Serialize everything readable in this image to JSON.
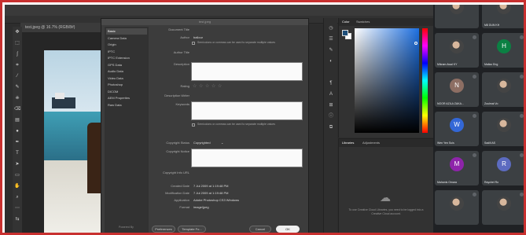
{
  "photoshop": {
    "document_tab": "test.jpeg @ 16.7% (RGB/8#)",
    "tools": [
      "move-icon",
      "marquee-icon",
      "lasso-icon",
      "crop-icon",
      "eyedropper-icon",
      "brush-icon",
      "stamp-icon",
      "eraser-icon",
      "gradient-icon",
      "dodge-icon",
      "pen-icon",
      "type-icon",
      "path-select-icon",
      "shape-icon",
      "hand-icon",
      "zoom-icon",
      "more-icon",
      "swap-colors-icon"
    ],
    "dialog": {
      "title": "test.jpeg",
      "sidebar": [
        "Basic",
        "Camera Data",
        "Origin",
        "IPTC",
        "IPTC Extension",
        "GPS Data",
        "Audio Data",
        "Video Data",
        "Photoshop",
        "DICOM",
        "AEM Properties",
        "Raw Data"
      ],
      "xmp_powered": "Powered By",
      "xmp_logo": "xmp",
      "fields": {
        "document_title_label": "Document Title",
        "author_label": "Author",
        "author_value": "ballour",
        "semicolon_note": "Semicolons or commas can be used to separate multiple values",
        "author_title_label": "Author Title",
        "description_label": "Description",
        "rating_label": "Rating",
        "description_writer_label": "Description Writer",
        "keywords_label": "Keywords",
        "keywords_note": "Semicolons or commas can be used to separate multiple values",
        "copyright_status_label": "Copyright Status",
        "copyright_status_value": "Copyrighted",
        "copyright_notice_label": "Copyright Notice",
        "copyright_info_label": "Copyright Info URL",
        "created_date_label": "Created Date",
        "created_date_value": "7 Jul 2009 at 1:19:48 PM",
        "modified_date_label": "Modification Date",
        "modified_date_value": "7 Jul 2009 at 1:19:48 PM",
        "application_label": "Application",
        "application_value": "Adobe Photoshop CS3 Windows",
        "format_label": "Format",
        "format_value": "image/jpeg"
      },
      "buttons": {
        "preferences": "Preferences",
        "template": "Template Fo...",
        "cancel": "Cancel",
        "ok": "OK"
      }
    },
    "color_panel": {
      "tabs": [
        "Color",
        "Swatches"
      ],
      "foreground_color": "#1e4f7a"
    },
    "libraries_panel": {
      "tabs": [
        "Libraries",
        "Adjustments"
      ],
      "message": "To use Creative Cloud Libraries, you need to be logged into a Creative Cloud account."
    }
  },
  "meeting": {
    "participants": [
      {
        "name": "",
        "initial": "",
        "color": "#3c4043"
      },
      {
        "name": "M8 DUN KH",
        "initial": "",
        "color": "#3c4043"
      },
      {
        "name": "Mikram Awal KY",
        "initial": "",
        "color": "#3c4043"
      },
      {
        "name": "Mallaz Eng",
        "initial": "H",
        "color": "#0b8043"
      },
      {
        "name": "NOOR AZILA ZAKA...",
        "initial": "N",
        "color": "#8d6e63"
      },
      {
        "name": "Zoulmai Vo",
        "initial": "",
        "color": "#3c4043"
      },
      {
        "name": "Wen Yen Suis",
        "initial": "W",
        "color": "#3367d6"
      },
      {
        "name": "Sadill AS",
        "initial": "",
        "color": "#3c4043"
      },
      {
        "name": "Mahanis Omara",
        "initial": "M",
        "color": "#8e24aa"
      },
      {
        "name": "Raychel Ro",
        "initial": "R",
        "color": "#5c6bc0"
      },
      {
        "name": "",
        "initial": "",
        "color": "#3c4043"
      },
      {
        "name": "",
        "initial": "",
        "color": "#3c4043"
      }
    ]
  }
}
